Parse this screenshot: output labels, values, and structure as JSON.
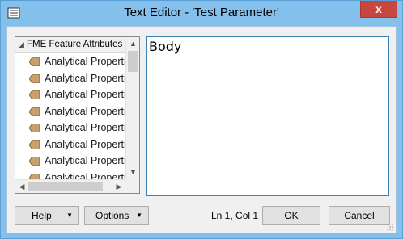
{
  "window": {
    "title": "Text Editor - 'Test Parameter'",
    "close_label": "x"
  },
  "tree": {
    "root_label": "FME Feature Attributes",
    "items": [
      "Analytical Propertie",
      "Analytical Propertie",
      "Analytical Propertie",
      "Analytical Propertie",
      "Analytical Propertie",
      "Analytical Propertie",
      "Analytical Propertie",
      "Analytical Propertie"
    ]
  },
  "editor": {
    "text": "Body"
  },
  "footer": {
    "help_label": "Help",
    "options_label": "Options",
    "cursor_position": "Ln 1, Col 1",
    "ok_label": "OK",
    "cancel_label": "Cancel"
  },
  "colors": {
    "titlebar": "#83c0ec",
    "close_button": "#c7463e",
    "editor_border": "#3c7fb1",
    "attribute_tag": "#c8a070"
  }
}
